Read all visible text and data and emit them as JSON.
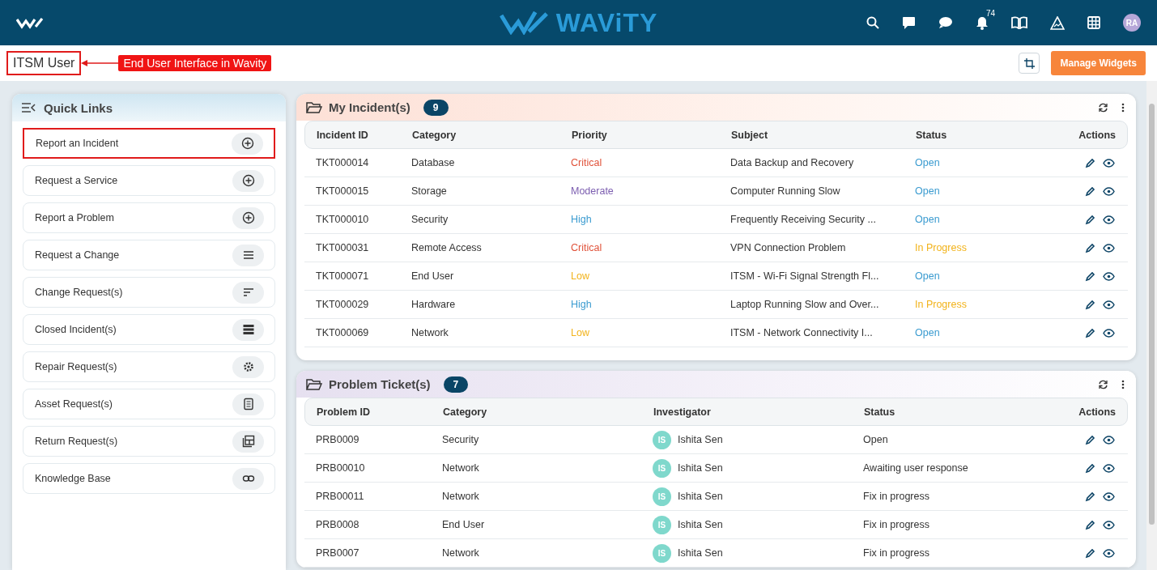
{
  "header": {
    "logo_text": "WAViTY",
    "notification_count": "74",
    "avatar_initials": "RA"
  },
  "subheader": {
    "title": "ITSM User",
    "title_highlighted": true,
    "annotation": "End User Interface in Wavity",
    "manage_button": "Manage Widgets"
  },
  "quick_links": {
    "title": "Quick Links",
    "items": [
      {
        "label": "Report an Incident",
        "kind": "plus",
        "highlighted": true
      },
      {
        "label": "Request a Service",
        "kind": "plus",
        "highlighted": false
      },
      {
        "label": "Report a Problem",
        "kind": "plus",
        "highlighted": false
      },
      {
        "label": "Request a Change",
        "kind": "lines",
        "highlighted": false
      },
      {
        "label": "Change Request(s)",
        "kind": "sort",
        "highlighted": false
      },
      {
        "label": "Closed Incident(s)",
        "kind": "list",
        "highlighted": false
      },
      {
        "label": "Repair Request(s)",
        "kind": "gear",
        "highlighted": false
      },
      {
        "label": "Asset Request(s)",
        "kind": "doc",
        "highlighted": false
      },
      {
        "label": "Return Request(s)",
        "kind": "gallery",
        "highlighted": false
      },
      {
        "label": "Knowledge Base",
        "kind": "link",
        "highlighted": false
      }
    ]
  },
  "incidents": {
    "title": "My Incident(s)",
    "count": "9",
    "columns": [
      "Incident ID",
      "Category",
      "Priority",
      "Subject",
      "Status",
      "Actions"
    ],
    "rows": [
      {
        "id": "TKT000014",
        "category": "Database",
        "priority": {
          "text": "Critical",
          "color": "#e0523a"
        },
        "subject": "Data Backup and Recovery",
        "status": {
          "text": "Open",
          "color": "#3a9bd0"
        }
      },
      {
        "id": "TKT000015",
        "category": "Storage",
        "priority": {
          "text": "Moderate",
          "color": "#7c5eb0"
        },
        "subject": "Computer Running Slow",
        "status": {
          "text": "Open",
          "color": "#3a9bd0"
        }
      },
      {
        "id": "TKT000010",
        "category": "Security",
        "priority": {
          "text": "High",
          "color": "#3a9bd0"
        },
        "subject": "Frequently Receiving Security ...",
        "status": {
          "text": "Open",
          "color": "#3a9bd0"
        }
      },
      {
        "id": "TKT000031",
        "category": "Remote Access",
        "priority": {
          "text": "Critical",
          "color": "#e0523a"
        },
        "subject": "VPN Connection Problem",
        "status": {
          "text": "In Progress",
          "color": "#f2b31b"
        }
      },
      {
        "id": "TKT000071",
        "category": "End User",
        "priority": {
          "text": "Low",
          "color": "#f2b31b"
        },
        "subject": "ITSM - Wi-Fi Signal Strength Fl...",
        "status": {
          "text": "Open",
          "color": "#3a9bd0"
        }
      },
      {
        "id": "TKT000029",
        "category": "Hardware",
        "priority": {
          "text": "High",
          "color": "#3a9bd0"
        },
        "subject": "Laptop Running Slow and Over...",
        "status": {
          "text": "In Progress",
          "color": "#f2b31b"
        }
      },
      {
        "id": "TKT000069",
        "category": "Network",
        "priority": {
          "text": "Low",
          "color": "#f2b31b"
        },
        "subject": "ITSM - Network Connectivity I...",
        "status": {
          "text": "Open",
          "color": "#3a9bd0"
        }
      }
    ]
  },
  "problems": {
    "title": "Problem Ticket(s)",
    "count": "7",
    "columns": [
      "Problem ID",
      "Category",
      "Investigator",
      "Status",
      "Actions"
    ],
    "rows": [
      {
        "id": "PRB0009",
        "category": "Security",
        "investigator_initials": "IS",
        "investigator": "Ishita Sen",
        "status": "Open"
      },
      {
        "id": "PRB00010",
        "category": "Network",
        "investigator_initials": "IS",
        "investigator": "Ishita Sen",
        "status": "Awaiting user response"
      },
      {
        "id": "PRB00011",
        "category": "Network",
        "investigator_initials": "IS",
        "investigator": "Ishita Sen",
        "status": "Fix in progress"
      },
      {
        "id": "PRB0008",
        "category": "End User",
        "investigator_initials": "IS",
        "investigator": "Ishita Sen",
        "status": "Fix in progress"
      },
      {
        "id": "PRB0007",
        "category": "Network",
        "investigator_initials": "IS",
        "investigator": "Ishita Sen",
        "status": "Fix in progress"
      }
    ]
  }
}
